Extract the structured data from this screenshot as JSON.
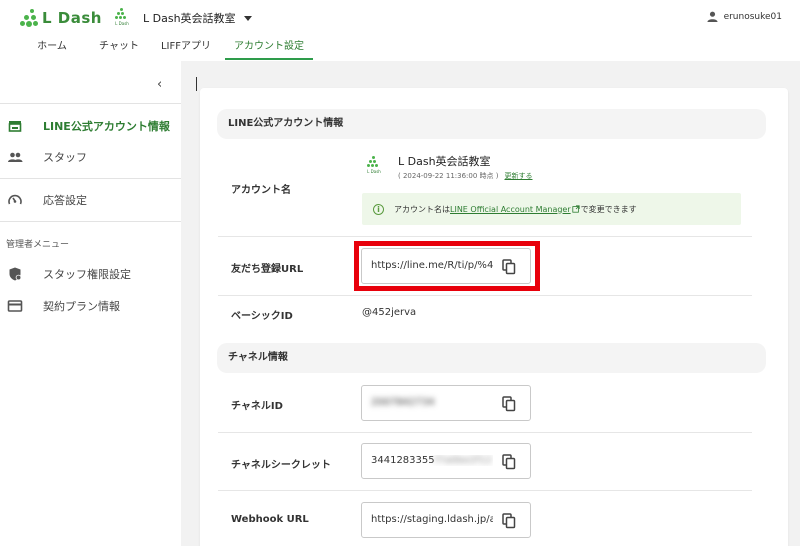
{
  "app": {
    "logo_text": "L Dash",
    "account_name": "L Dash英会話教室",
    "mini_logo_text": "L Dash",
    "user_name": "erunosuke01"
  },
  "tabs": [
    {
      "label": "ホーム"
    },
    {
      "label": "チャット"
    },
    {
      "label": "LIFFアプリ"
    },
    {
      "label": "アカウント設定",
      "active": true
    }
  ],
  "sidebar": {
    "items": [
      {
        "label": "LINE公式アカウント情報",
        "icon": "store-icon",
        "active": true
      },
      {
        "label": "スタッフ",
        "icon": "people-icon"
      },
      {
        "label": "応答設定",
        "icon": "gauge-icon"
      }
    ],
    "admin_section_label": "管理者メニュー",
    "admin_items": [
      {
        "label": "スタッフ権限設定",
        "icon": "shield-icon"
      },
      {
        "label": "契約プラン情報",
        "icon": "card-icon"
      }
    ]
  },
  "line_info": {
    "section_title": "LINE公式アカウント情報",
    "account_label": "アカウント名",
    "account_name": "L Dash英会話教室",
    "timestamp": "( 2024-09-22 11:36:00 時点 )",
    "update_link": "更新する",
    "notice_prefix": "アカウント名は",
    "notice_link": "LINE Official Account Manager",
    "notice_suffix": "で変更できます",
    "friend_url_label": "友だち登録URL",
    "friend_url_value": "https://line.me/R/ti/p/%4",
    "basic_id_label": "ベーシックID",
    "basic_id_value": "@452jerva"
  },
  "channel_info": {
    "section_title": "チャネル情報",
    "channel_id_label": "チャネルID",
    "channel_id_value": "2007842734",
    "channel_secret_label": "チャネルシークレット",
    "channel_secret_value": "3441283355",
    "channel_secret_hidden": "f7a0be2f12",
    "webhook_label": "Webhook URL",
    "webhook_value": "https://staging.ldash.jp/a"
  },
  "colors": {
    "accent": "#2e7d32",
    "highlight_box": "#e8000b",
    "notice_bg": "#eef7e9"
  }
}
